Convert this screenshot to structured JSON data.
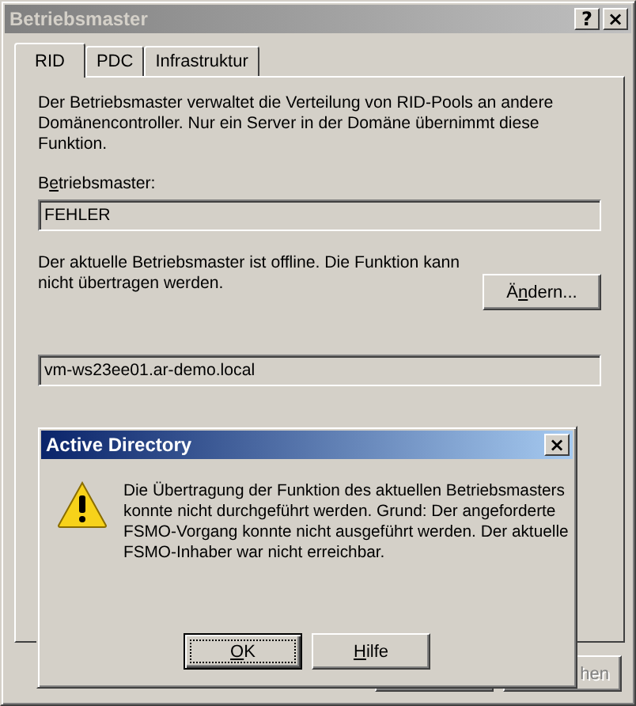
{
  "window": {
    "title": "Betriebsmaster",
    "active": false
  },
  "title_buttons": [
    {
      "label": "?"
    },
    {
      "label": "×"
    }
  ],
  "tabs": [
    {
      "label": "RID",
      "selected": true
    },
    {
      "label": "PDC",
      "selected": false
    },
    {
      "label": "Infrastruktur",
      "selected": false
    }
  ],
  "panel": {
    "description": "Der Betriebsmaster verwaltet die Verteilung von RID-Pools an andere Domänencontroller. Nur ein Server in der Domäne übernimmt diese Funktion.",
    "master_label": {
      "before": "B",
      "underlined": "e",
      "after": "triebsmaster:"
    },
    "master_value": "FEHLER",
    "status_text": "Der aktuelle Betriebsmaster ist offline. Die Funktion kann nicht übertragen werden.",
    "change_button": {
      "before": "Ä",
      "underlined": "n",
      "after": "dern..."
    },
    "target_value": "vm-ws23ee01.ar-demo.local"
  },
  "footer_button": {
    "label": "hen",
    "disabled": true
  },
  "dialog": {
    "title": "Active Directory",
    "active": true,
    "message": "Die Übertragung der Funktion des aktuellen Betriebsmasters konnte nicht durchgeführt werden. Grund: Der angeforderte FSMO-Vorgang konnte nicht ausgeführt werden. Der aktuelle FSMO-Inhaber war nicht erreichbar.",
    "close_label": "×",
    "buttons": [
      {
        "underlined": "O",
        "after": "K",
        "selected": true
      },
      {
        "underlined": "H",
        "after": "ilfe",
        "selected": false
      }
    ]
  }
}
